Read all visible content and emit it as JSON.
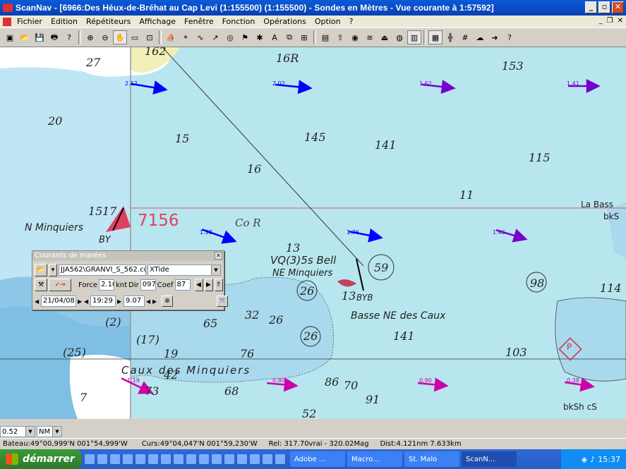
{
  "window": {
    "title": "ScanNav - [6966:Des Héux-de-Bréhat au Cap Levi (1:155500) (1:155500) - Sondes en  Mètres  - Vue courante à 1:57592]"
  },
  "menu": {
    "items": [
      "Fichier",
      "Edition",
      "Répétiteurs",
      "Affichage",
      "Fenêtre",
      "Fonction",
      "Opérations",
      "Option",
      "?"
    ]
  },
  "toolbar": {
    "icons": [
      "new-chart-icon",
      "open-icon",
      "save-icon",
      "print-icon",
      "help-cursor-icon",
      "zoom-in-icon",
      "zoom-out-icon",
      "pan-hand-icon",
      "rect-select-icon",
      "measure-icon",
      "boat-icon",
      "crosshair-icon",
      "route-icon",
      "track-icon",
      "bearing-icon",
      "waypoint-icon",
      "mark-icon",
      "text-icon",
      "multi-window-icon",
      "gps-icon",
      "nmea-icon",
      "north-icon",
      "target-icon",
      "tide-icon",
      "alarm-icon",
      "lifebuoy-icon",
      "chart-list-icon",
      "layers-icon",
      "grid-icon",
      "grid2-icon",
      "weather-icon",
      "current-arrow-icon",
      "tide-help-icon"
    ]
  },
  "map": {
    "depths": [
      "27",
      "162",
      "16R",
      "153",
      "20",
      "15",
      "145",
      "141",
      "115",
      "16",
      "11",
      "15",
      "17",
      "13",
      "59",
      "98",
      "114",
      "26",
      "13",
      "32",
      "26",
      "65",
      "26",
      "141",
      "7",
      "(2)",
      "(17)",
      "19",
      "42",
      "76",
      "103",
      "(25)",
      "73",
      "68",
      "86",
      "70",
      "91",
      "52"
    ],
    "labels": {
      "chart_no": "7156",
      "co_r": "Co R",
      "n_minquiers": "N Minquiers",
      "by": "BY",
      "vq": "VQ(3)5s Bell",
      "ne_minquiers": "NE Minquiers",
      "byb": "BYB",
      "basse": "Basse NE des Caux",
      "caux": "Caux  des  Minquiers",
      "la_bass": "La Bass",
      "bksh": "bkS",
      "bksh_cs": "bkSh cS",
      "p": "P"
    },
    "currents": [
      "2.12",
      "2.02",
      "1.62",
      "1.41",
      "1.98",
      "1.76",
      "1.46",
      "1.19",
      "0.80",
      "0.90",
      "0.38"
    ]
  },
  "dialog": {
    "title": "Courants de marées",
    "file": "JJA562\\GRANVI_S_562.cur",
    "source": "XTide",
    "force_label": "Force",
    "force": "2.10",
    "force_unit": "knt",
    "dir_label": "Dir",
    "dir": "097",
    "coef_label": "Coef",
    "coef": "87",
    "date": "21/04/08",
    "time": "19:29",
    "tide_height": "9.07"
  },
  "status": {
    "zoom_sel": "0.52",
    "unit_sel": "NM",
    "bateau": "Bateau:49°00,999'N 001°54,999'W",
    "curs": "Curs:49°04,047'N 001°59,230'W",
    "rel": "Rel: 317.70vrai - 320.02Mag",
    "dist": "Dist:4.121nm  7.633km"
  },
  "taskbar": {
    "start": "démarrer",
    "tasks": [
      "Adobe ...",
      "Macro...",
      "St. Malo",
      "ScanN..."
    ],
    "time": "15:37"
  },
  "colors": {
    "land": "#f2efb9",
    "water": "#b8e6ee",
    "shallow": "#8ec7e8",
    "current_blue": "#0000ff",
    "current_purple": "#7700cc",
    "current_magenta": "#cc00aa"
  }
}
